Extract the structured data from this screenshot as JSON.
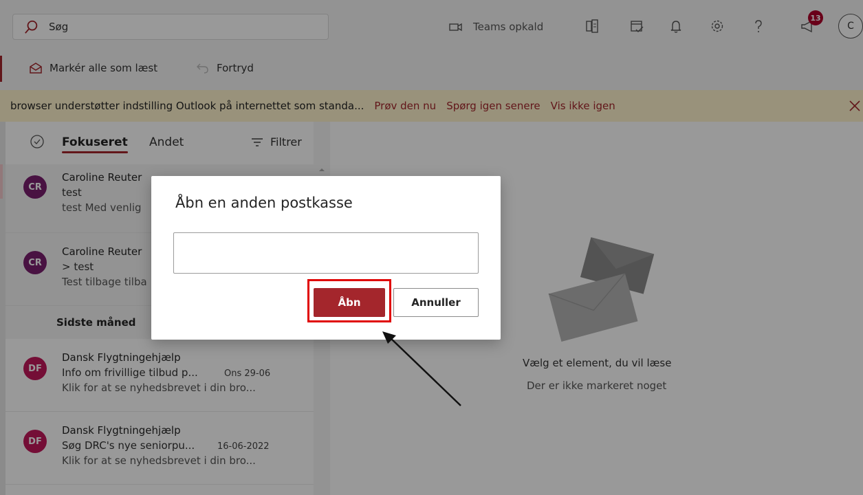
{
  "search": {
    "placeholder": "Søg"
  },
  "topbar": {
    "teams_label": "Teams opkald",
    "notification_count": "13",
    "user_initial": "C"
  },
  "command_bar": {
    "mark_all_read": "Markér alle som læst",
    "undo": "Fortryd"
  },
  "banner": {
    "message": "browser understøtter indstilling Outlook på internettet som standa...",
    "try_now": "Prøv den nu",
    "ask_later": "Spørg igen senere",
    "dont_show": "Vis ikke igen"
  },
  "mail_list": {
    "tab_focused": "Fokuseret",
    "tab_other": "Andet",
    "filter_label": "Filtrer",
    "section_last_month": "Sidste måned",
    "items": [
      {
        "initials": "CR",
        "sender": "Caroline Reuter",
        "subject": "test",
        "preview": "test Med venlig",
        "date": "",
        "color": "#7a1e6e"
      },
      {
        "initials": "CR",
        "sender": "Caroline Reuter",
        "subject": "> test",
        "preview": "Test tilbage tilba",
        "date": "",
        "color": "#7a1e6e"
      },
      {
        "initials": "DF",
        "sender": "Dansk Flygtningehjælp",
        "subject": "Info om frivillige tilbud p...",
        "preview": "Klik for at se nyhedsbrevet i din bro...",
        "date": "Ons 29-06",
        "color": "#c2185b"
      },
      {
        "initials": "DF",
        "sender": "Dansk Flygtningehjælp",
        "subject": "Søg DRC's nye seniorpu...",
        "preview": "Klik for at se nyhedsbrevet i din bro...",
        "date": "16-06-2022",
        "color": "#c2185b"
      }
    ]
  },
  "reading_pane": {
    "title": "Vælg et element, du vil læse",
    "subtitle": "Der er ikke markeret noget"
  },
  "dialog": {
    "title": "Åbn en anden postkasse",
    "input_value": "",
    "open_label": "Åbn",
    "cancel_label": "Annuller"
  },
  "colors": {
    "accent": "#a4262c",
    "banner_bg": "#fff4ce",
    "highlight": "#e00000"
  }
}
